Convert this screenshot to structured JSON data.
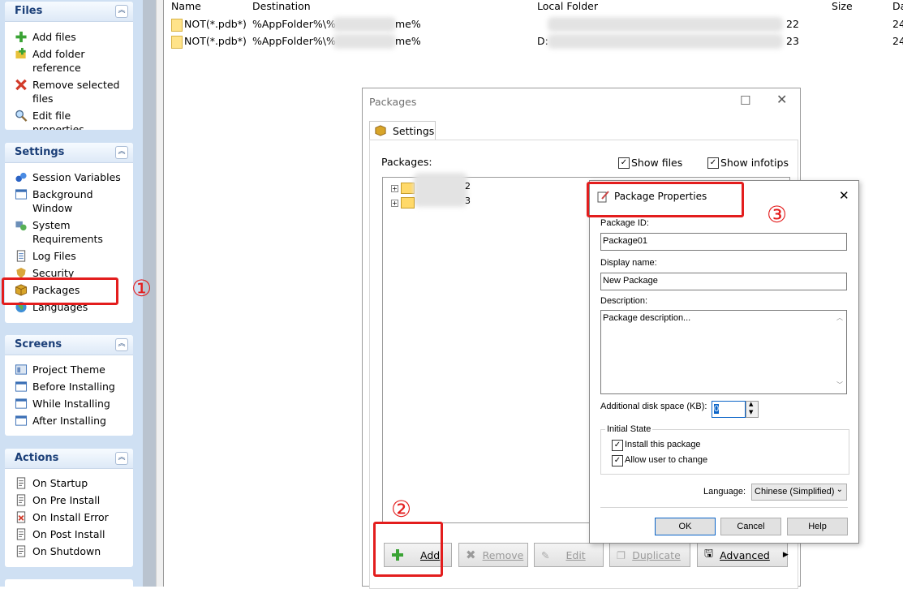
{
  "left_panels": {
    "files": {
      "title": "Files",
      "items": [
        {
          "label": "Add files",
          "icon": "add-files-icon"
        },
        {
          "label": "Add folder reference",
          "icon": "add-folder-icon"
        },
        {
          "label": "Remove selected files",
          "icon": "remove-icon"
        },
        {
          "label": "Edit file properties",
          "icon": "magnifier-icon"
        }
      ]
    },
    "settings": {
      "title": "Settings",
      "items": [
        {
          "label": "Session Variables"
        },
        {
          "label": "Background Window"
        },
        {
          "label": "System Requirements"
        },
        {
          "label": "Log Files"
        },
        {
          "label": "Security"
        },
        {
          "label": "Packages"
        },
        {
          "label": "Languages"
        }
      ]
    },
    "screens": {
      "title": "Screens",
      "items": [
        {
          "label": "Project Theme"
        },
        {
          "label": "Before Installing"
        },
        {
          "label": "While Installing"
        },
        {
          "label": "After Installing"
        }
      ]
    },
    "actions": {
      "title": "Actions",
      "items": [
        {
          "label": "On Startup"
        },
        {
          "label": "On Pre Install"
        },
        {
          "label": "On Install Error"
        },
        {
          "label": "On Post Install"
        },
        {
          "label": "On Shutdown"
        }
      ]
    }
  },
  "file_list": {
    "columns": [
      "Name",
      "Destination",
      "Local Folder",
      "Size",
      "Da"
    ],
    "rows": [
      {
        "name": "NOT(*.pdb*)",
        "dest_start": "%AppFolder%\\%",
        "dest_end": "me%",
        "local": "",
        "size_tail": "22",
        "date": "24"
      },
      {
        "name": "NOT(*.pdb*)",
        "dest_start": "%AppFolder%\\%",
        "dest_end": "me%",
        "local": "D:",
        "size_tail": "23",
        "date": "24"
      }
    ]
  },
  "packages_dialog": {
    "title": "Packages",
    "tab": "Settings",
    "packages_label": "Packages:",
    "show_files": "Show files",
    "show_infotips": "Show infotips",
    "tree_items": [
      "2",
      "3"
    ],
    "buttons": {
      "add": "Add",
      "remove": "Remove",
      "edit": "Edit",
      "duplicate": "Duplicate",
      "advanced": "Advanced"
    }
  },
  "package_properties": {
    "title": "Package Properties",
    "package_id_label": "Package ID:",
    "package_id": "Package01",
    "display_name_label": "Display name:",
    "display_name": "New Package",
    "description_label": "Description:",
    "description": "Package description...",
    "disk_space_label": "Additional disk space (KB):",
    "disk_space": "0",
    "initial_state_label": "Initial State",
    "install_this_package": "Install this package",
    "allow_user_change": "Allow user to change",
    "language_label": "Language:",
    "language_value": "Chinese (Simplified)",
    "ok": "OK",
    "cancel": "Cancel",
    "help": "Help"
  },
  "annotations": {
    "one": "①",
    "two": "②",
    "three": "③"
  },
  "colors": {
    "annotation_red": "#e31d1d",
    "panel_title": "#1b3f78",
    "pane_bg": "#cfe0f3"
  }
}
